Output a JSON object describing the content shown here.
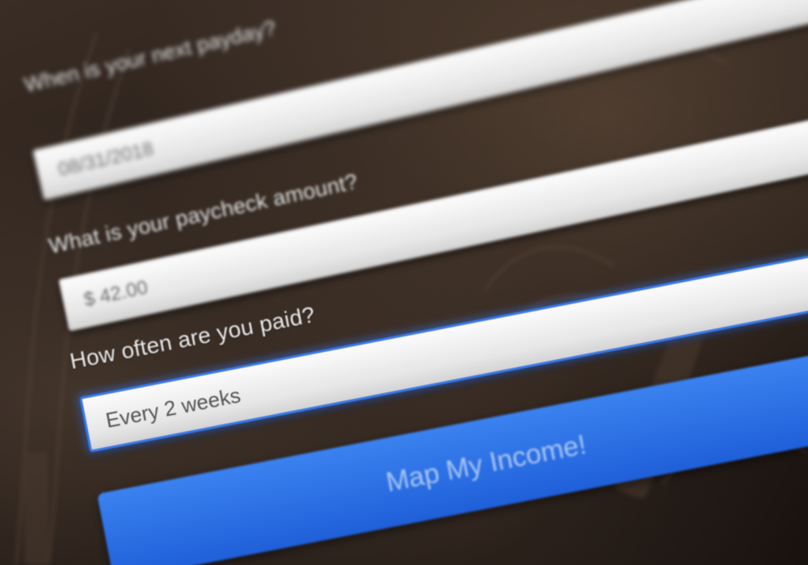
{
  "form": {
    "payday_label": "When is your next payday?",
    "payday_value": "08/31/2018",
    "amount_label": "What is your paycheck amount?",
    "amount_value": "$ 42.00",
    "frequency_label": "How often are you paid?",
    "frequency_value": "Every 2 weeks",
    "submit_label": "Map My Income!"
  },
  "colors": {
    "accent": "#3b78e7",
    "button": "#1f5fd9",
    "background": "#1e1713"
  }
}
